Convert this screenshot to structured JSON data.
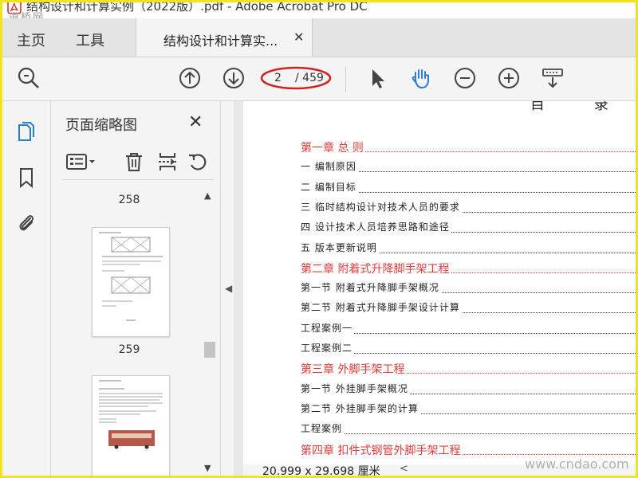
{
  "window": {
    "title": "结构设计和计算实例（2022版）.pdf - Adobe Acrobat Pro DC",
    "watermark_top": "道桥网"
  },
  "tabs": {
    "home_label": "主页",
    "tools_label": "工具",
    "doc_tab_label": "结构设计和计算实...",
    "close_glyph": "✕"
  },
  "toolbar": {
    "page_current": "2",
    "page_total": "/ 459",
    "icons": [
      "search-icon",
      "page-up-icon",
      "page-down-icon",
      "select-cursor-icon",
      "hand-tool-icon",
      "zoom-out-icon",
      "zoom-in-icon",
      "scroll-mode-icon"
    ]
  },
  "rail": {
    "icons": [
      "page-thumbnails-icon",
      "bookmark-icon",
      "attachment-icon"
    ]
  },
  "thumbnails_panel": {
    "title": "页面缩略图",
    "close_glyph": "✕",
    "pages": [
      {
        "label": "258"
      },
      {
        "label": "259"
      }
    ],
    "tools": [
      "thumbnail-options-icon",
      "delete-page-icon",
      "extract-page-icon",
      "rotate-page-icon"
    ]
  },
  "document": {
    "heading": "目 录",
    "toc": [
      {
        "kind": "chapter",
        "text": "第一章 总 则"
      },
      {
        "kind": "section",
        "text": "一 编制原因"
      },
      {
        "kind": "section",
        "text": "二 编制目标"
      },
      {
        "kind": "section",
        "text": "三 临时结构设计对技术人员的要求"
      },
      {
        "kind": "section",
        "text": "四 设计技术人员培养思路和途径"
      },
      {
        "kind": "section",
        "text": "五 版本更新说明"
      },
      {
        "kind": "chapter",
        "text": "第二章 附着式升降脚手架工程"
      },
      {
        "kind": "section",
        "text": "第一节 附着式升降脚手架概况"
      },
      {
        "kind": "section",
        "text": "第二节 附着式升降脚手架设计计算"
      },
      {
        "kind": "section",
        "text": "工程案例一"
      },
      {
        "kind": "section",
        "text": "工程案例二"
      },
      {
        "kind": "chapter",
        "text": "第三章 外脚手架工程"
      },
      {
        "kind": "section",
        "text": "第一节 外挂脚手架概况"
      },
      {
        "kind": "section",
        "text": "第二节 外挂脚手架的计算"
      },
      {
        "kind": "section",
        "text": "工程案例"
      },
      {
        "kind": "chapter",
        "text": "第四章 扣件式钢管外脚手架工程"
      }
    ]
  },
  "status": {
    "page_size": "20.999 x 29.698 厘米",
    "watermark_bottom": "www.cndao.com"
  },
  "colors": {
    "chapter_red": "#e23b3b",
    "oval_red": "#d42020",
    "acrobat_blue": "#2b7cd3",
    "border_yellow": "#f2e31d"
  }
}
